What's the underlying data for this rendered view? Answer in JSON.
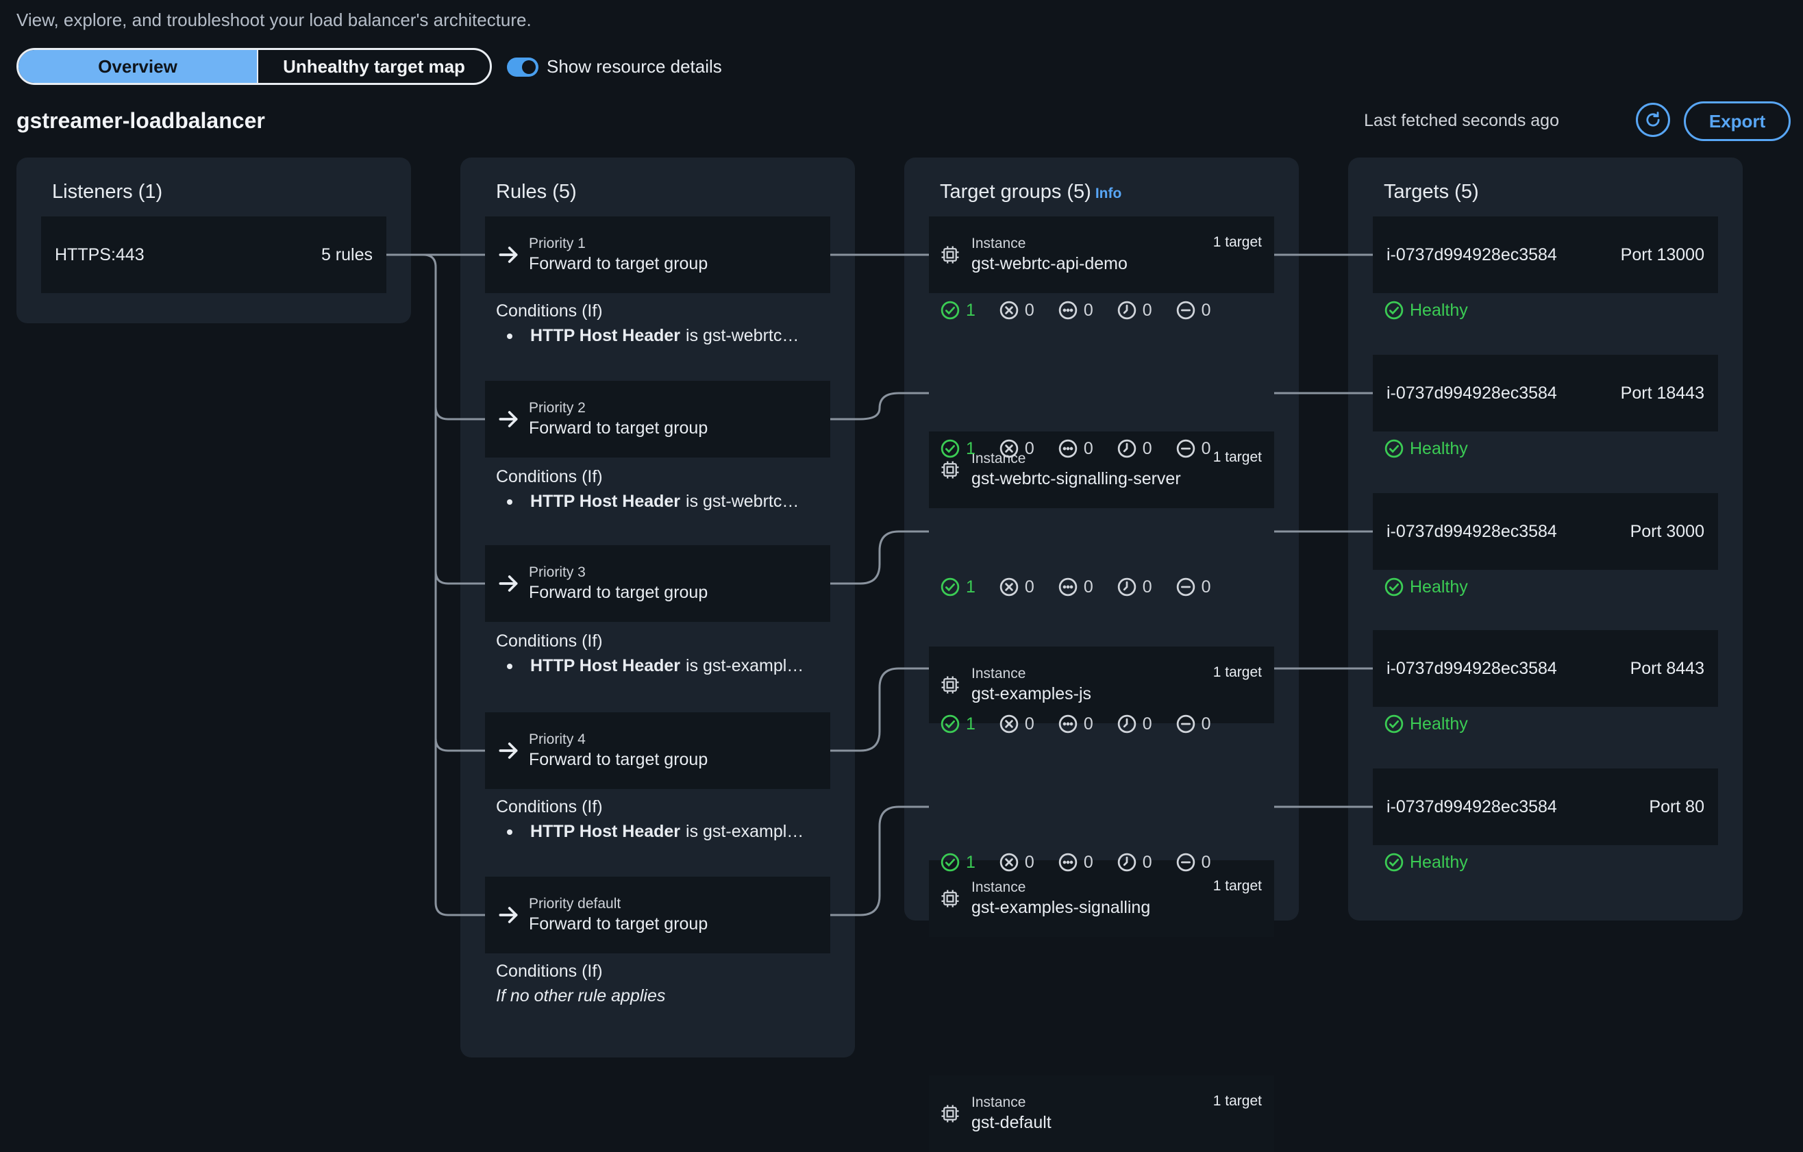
{
  "header": {
    "subtitle": "View, explore, and troubleshoot your load balancer's architecture.",
    "tabs": [
      "Overview",
      "Unhealthy target map"
    ],
    "toggle_label": "Show resource details",
    "toggle_on": true,
    "lb_name": "gstreamer-loadbalancer",
    "last_fetched": "Last fetched seconds ago",
    "export_label": "Export"
  },
  "listeners": {
    "title": "Listeners (1)",
    "items": [
      {
        "name": "HTTPS:443",
        "rules": "5 rules"
      }
    ]
  },
  "rules": {
    "title": "Rules (5)",
    "conditions_label": "Conditions (If)",
    "items": [
      {
        "priority": "Priority 1",
        "action": "Forward to target group",
        "cond_key": "HTTP Host Header",
        "cond_rest": "is gst-webrtc…"
      },
      {
        "priority": "Priority 2",
        "action": "Forward to target group",
        "cond_key": "HTTP Host Header",
        "cond_rest": "is gst-webrtc…"
      },
      {
        "priority": "Priority 3",
        "action": "Forward to target group",
        "cond_key": "HTTP Host Header",
        "cond_rest": "is gst-exampl…"
      },
      {
        "priority": "Priority 4",
        "action": "Forward to target group",
        "cond_key": "HTTP Host Header",
        "cond_rest": "is gst-exampl…"
      },
      {
        "priority": "Priority default",
        "action": "Forward to target group",
        "cond_italic": "If no other rule applies"
      }
    ]
  },
  "target_groups": {
    "title": "Target groups (5)",
    "info": "Info",
    "items": [
      {
        "type": "Instance",
        "name": "gst-webrtc-api-demo",
        "count": "1 target",
        "stats": [
          "1",
          "0",
          "0",
          "0",
          "0"
        ]
      },
      {
        "type": "Instance",
        "name": "gst-webrtc-signalling-server",
        "count": "1 target",
        "stats": [
          "1",
          "0",
          "0",
          "0",
          "0"
        ]
      },
      {
        "type": "Instance",
        "name": "gst-examples-js",
        "count": "1 target",
        "stats": [
          "1",
          "0",
          "0",
          "0",
          "0"
        ]
      },
      {
        "type": "Instance",
        "name": "gst-examples-signalling",
        "count": "1 target",
        "stats": [
          "1",
          "0",
          "0",
          "0",
          "0"
        ]
      },
      {
        "type": "Instance",
        "name": "gst-default",
        "count": "1 target",
        "stats": [
          "1",
          "0",
          "0",
          "0",
          "0"
        ]
      }
    ]
  },
  "targets": {
    "title": "Targets (5)",
    "items": [
      {
        "id": "i-0737d994928ec3584",
        "port": "Port 13000",
        "status": "Healthy"
      },
      {
        "id": "i-0737d994928ec3584",
        "port": "Port 18443",
        "status": "Healthy"
      },
      {
        "id": "i-0737d994928ec3584",
        "port": "Port 3000",
        "status": "Healthy"
      },
      {
        "id": "i-0737d994928ec3584",
        "port": "Port 8443",
        "status": "Healthy"
      },
      {
        "id": "i-0737d994928ec3584",
        "port": "Port 80",
        "status": "Healthy"
      }
    ]
  },
  "colors": {
    "background": "#0f141a",
    "panel": "#1b232d",
    "card": "#10161c",
    "accent": "#58a6f5",
    "healthy": "#3bcc54",
    "connector": "#8a939e"
  },
  "icons": {
    "rule_action": "arrow-right-icon",
    "target_group": "instance-chip-icon",
    "stats": [
      "healthy-check-icon",
      "unhealthy-x-icon",
      "unused-dots-icon",
      "initial-clock-icon",
      "draining-minus-icon"
    ],
    "refresh": "refresh-icon"
  }
}
